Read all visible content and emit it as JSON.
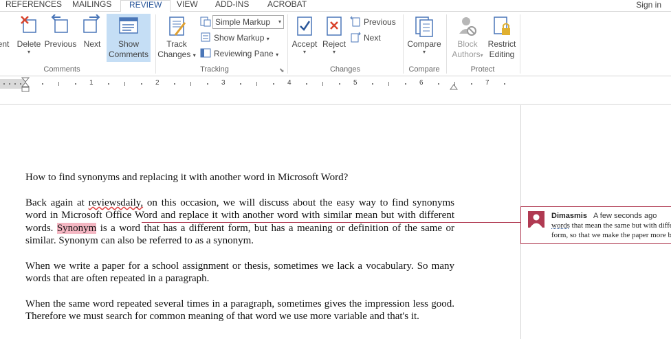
{
  "tabs": {
    "references": "REFERENCES",
    "mailings": "MAILINGS",
    "review": "REVIEW",
    "view": "VIEW",
    "addins": "ADD-INS",
    "acrobat": "ACROBAT",
    "signin": "Sign in"
  },
  "ribbon": {
    "comments": {
      "partial_label": "ent",
      "delete": "Delete",
      "previous": "Previous",
      "next": "Next",
      "show_comments_1": "Show",
      "show_comments_2": "Comments",
      "group_label": "Comments"
    },
    "tracking": {
      "track_changes_1": "Track",
      "track_changes_2": "Changes",
      "markup_combo": "Simple Markup",
      "show_markup": "Show Markup",
      "reviewing_pane": "Reviewing Pane",
      "group_label": "Tracking"
    },
    "changes": {
      "accept": "Accept",
      "reject": "Reject",
      "previous": "Previous",
      "next": "Next",
      "group_label": "Changes"
    },
    "compare": {
      "compare": "Compare",
      "group_label": "Compare"
    },
    "protect": {
      "block_authors_1": "Block",
      "block_authors_2": "Authors",
      "restrict_editing_1": "Restrict",
      "restrict_editing_2": "Editing",
      "group_label": "Protect"
    }
  },
  "ruler": {
    "numbers": [
      "1",
      "2",
      "3",
      "4",
      "5",
      "6",
      "7"
    ]
  },
  "document": {
    "title_line": "How to find synonyms and replacing it with another word in Microsoft Word?",
    "p1_before": "Back again at ",
    "p1_misspelled": "reviewsdaily,",
    "p1_middle": " on this occasion, we will discuss about the easy way to find synonyms word in Microsoft Office Word and replace it with another word with similar mean but with different words. ",
    "p1_highlight": "Synonym",
    "p1_after": " is a word that has a different form, but has a meaning or definition of the same or similar. Synonym can also be referred to as a synonym.",
    "p2": "When we write a paper for a school assignment or thesis, sometimes we lack a vocabulary. So many words that are often repeated in a paragraph.",
    "p3": "When the same word repeated several times in a paragraph, sometimes gives the impression less good. Therefore we must search for common meaning of that word we use more variable and that's it."
  },
  "comment": {
    "author": "Dimasmis",
    "time": "A few seconds ago",
    "text_start": "words",
    "text_rest": " that mean the same but with different form, so that we make the paper more better."
  },
  "colors": {
    "accent": "#2b579a",
    "comment": "#b03a52",
    "highlight": "#f4b6c2"
  }
}
